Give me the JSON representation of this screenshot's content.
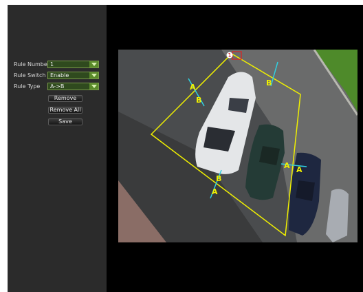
{
  "panel": {
    "rule_number_label": "Rule Number",
    "rule_number_value": "1",
    "rule_switch_label": "Rule Switch",
    "rule_switch_value": "Enable",
    "rule_type_label": "Rule Type",
    "rule_type_value": "A->B",
    "remove_label": "Remove",
    "remove_all_label": "Remove All",
    "save_label": "Save"
  },
  "camera": {
    "region_marker": "1",
    "markers": [
      "A",
      "B",
      "A",
      "B",
      "B",
      "A"
    ]
  },
  "colors": {
    "panel_bg": "#2b2b2b",
    "field_bg": "#2f4a1e",
    "field_arrow": "#5a8a2a",
    "zone_line": "#f0f000",
    "direction_arrow": "#30d0e0"
  }
}
